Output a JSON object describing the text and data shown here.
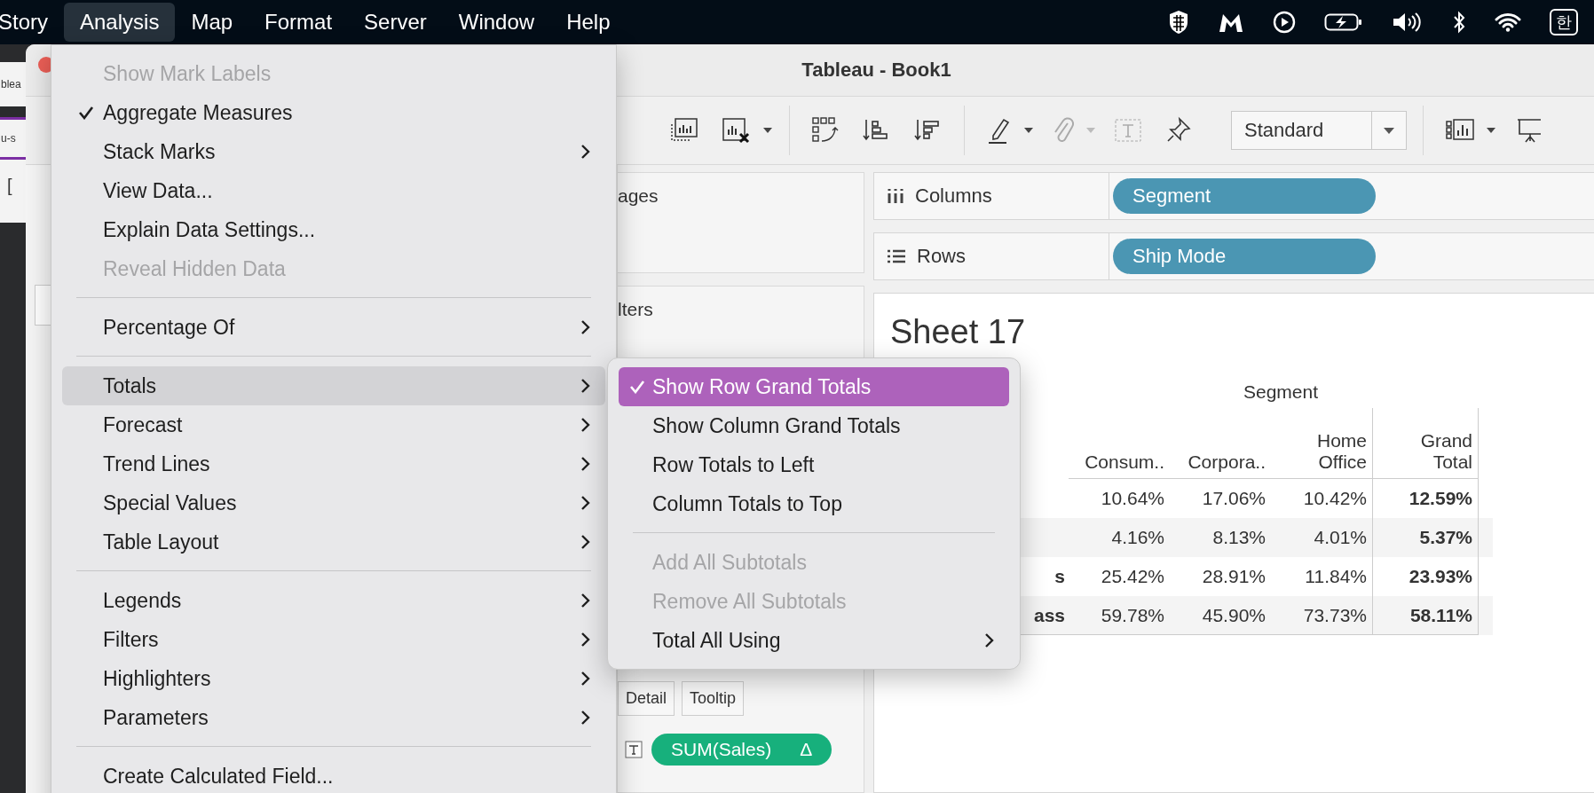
{
  "menubar": {
    "items": [
      {
        "label": "Story",
        "selected": false
      },
      {
        "label": "Analysis",
        "selected": true
      },
      {
        "label": "Map",
        "selected": false
      },
      {
        "label": "Format",
        "selected": false
      },
      {
        "label": "Server",
        "selected": false
      },
      {
        "label": "Window",
        "selected": false
      },
      {
        "label": "Help",
        "selected": false
      }
    ],
    "input_source": "한"
  },
  "back_window": {
    "fragments": [
      "blea",
      "u-s",
      "["
    ]
  },
  "window": {
    "title": "Tableau - Book1"
  },
  "toolbar": {
    "fit_select": "Standard"
  },
  "cards": {
    "pages": "ages",
    "filters": "lters",
    "mark_buttons": [
      "Detail",
      "Tooltip"
    ],
    "pill": "SUM(Sales)",
    "pill_icon": "Δ"
  },
  "shelves": [
    {
      "kind": "columns",
      "label": "Columns",
      "pill": "Segment"
    },
    {
      "kind": "rows",
      "label": "Rows",
      "pill": "Ship Mode"
    }
  ],
  "sheet": {
    "title": "Sheet 17",
    "super_header": "Segment",
    "columns": [
      {
        "label": "Consum..",
        "kind": "segment"
      },
      {
        "label": "Corpora..",
        "kind": "segment"
      },
      {
        "label": "Home\nOffice",
        "kind": "segment"
      },
      {
        "label": "Grand\nTotal",
        "kind": "grand_total"
      }
    ],
    "rows": [
      {
        "cells": [
          "10.64%",
          "17.06%",
          "10.42%",
          "12.59%"
        ]
      },
      {
        "cells": [
          "4.16%",
          "8.13%",
          "4.01%",
          "5.37%"
        ]
      },
      {
        "label": "s",
        "cells": [
          "25.42%",
          "28.91%",
          "11.84%",
          "23.93%"
        ]
      },
      {
        "label": "ass",
        "cells": [
          "59.78%",
          "45.90%",
          "73.73%",
          "58.11%"
        ]
      }
    ]
  },
  "analysis_menu": {
    "items": [
      {
        "kind": "item",
        "label": "Show Mark Labels",
        "checked": false,
        "disabled": true,
        "submenu": false,
        "selected": false
      },
      {
        "kind": "item",
        "label": "Aggregate Measures",
        "checked": true,
        "disabled": false,
        "submenu": false,
        "selected": false
      },
      {
        "kind": "item",
        "label": "Stack Marks",
        "checked": false,
        "disabled": false,
        "submenu": true,
        "selected": false
      },
      {
        "kind": "item",
        "label": "View Data...",
        "checked": false,
        "disabled": false,
        "submenu": false,
        "selected": false
      },
      {
        "kind": "item",
        "label": "Explain Data Settings...",
        "checked": false,
        "disabled": false,
        "submenu": false,
        "selected": false
      },
      {
        "kind": "item",
        "label": "Reveal Hidden Data",
        "checked": false,
        "disabled": true,
        "submenu": false,
        "selected": false
      },
      {
        "kind": "separator"
      },
      {
        "kind": "item",
        "label": "Percentage Of",
        "checked": false,
        "disabled": false,
        "submenu": true,
        "selected": false
      },
      {
        "kind": "separator"
      },
      {
        "kind": "item",
        "label": "Totals",
        "checked": false,
        "disabled": false,
        "submenu": true,
        "selected": true
      },
      {
        "kind": "item",
        "label": "Forecast",
        "checked": false,
        "disabled": false,
        "submenu": true,
        "selected": false
      },
      {
        "kind": "item",
        "label": "Trend Lines",
        "checked": false,
        "disabled": false,
        "submenu": true,
        "selected": false
      },
      {
        "kind": "item",
        "label": "Special Values",
        "checked": false,
        "disabled": false,
        "submenu": true,
        "selected": false
      },
      {
        "kind": "item",
        "label": "Table Layout",
        "checked": false,
        "disabled": false,
        "submenu": true,
        "selected": false
      },
      {
        "kind": "separator"
      },
      {
        "kind": "item",
        "label": "Legends",
        "checked": false,
        "disabled": false,
        "submenu": true,
        "selected": false
      },
      {
        "kind": "item",
        "label": "Filters",
        "checked": false,
        "disabled": false,
        "submenu": true,
        "selected": false
      },
      {
        "kind": "item",
        "label": "Highlighters",
        "checked": false,
        "disabled": false,
        "submenu": true,
        "selected": false
      },
      {
        "kind": "item",
        "label": "Parameters",
        "checked": false,
        "disabled": false,
        "submenu": true,
        "selected": false
      },
      {
        "kind": "separator"
      },
      {
        "kind": "item",
        "label": "Create Calculated Field...",
        "checked": false,
        "disabled": false,
        "submenu": false,
        "selected": false
      }
    ]
  },
  "totals_submenu": {
    "items": [
      {
        "kind": "item",
        "label": "Show Row Grand Totals",
        "checked": true,
        "disabled": false,
        "submenu": false,
        "selected": true
      },
      {
        "kind": "item",
        "label": "Show Column Grand Totals",
        "checked": false,
        "disabled": false,
        "submenu": false,
        "selected": false
      },
      {
        "kind": "item",
        "label": "Row Totals to Left",
        "checked": false,
        "disabled": false,
        "submenu": false,
        "selected": false
      },
      {
        "kind": "item",
        "label": "Column Totals to Top",
        "checked": false,
        "disabled": false,
        "submenu": false,
        "selected": false
      },
      {
        "kind": "separator"
      },
      {
        "kind": "item",
        "label": "Add All Subtotals",
        "checked": false,
        "disabled": true,
        "submenu": false,
        "selected": false
      },
      {
        "kind": "item",
        "label": "Remove All Subtotals",
        "checked": false,
        "disabled": true,
        "submenu": false,
        "selected": false
      },
      {
        "kind": "item",
        "label": "Total All Using",
        "checked": false,
        "disabled": false,
        "submenu": true,
        "selected": false
      }
    ]
  }
}
